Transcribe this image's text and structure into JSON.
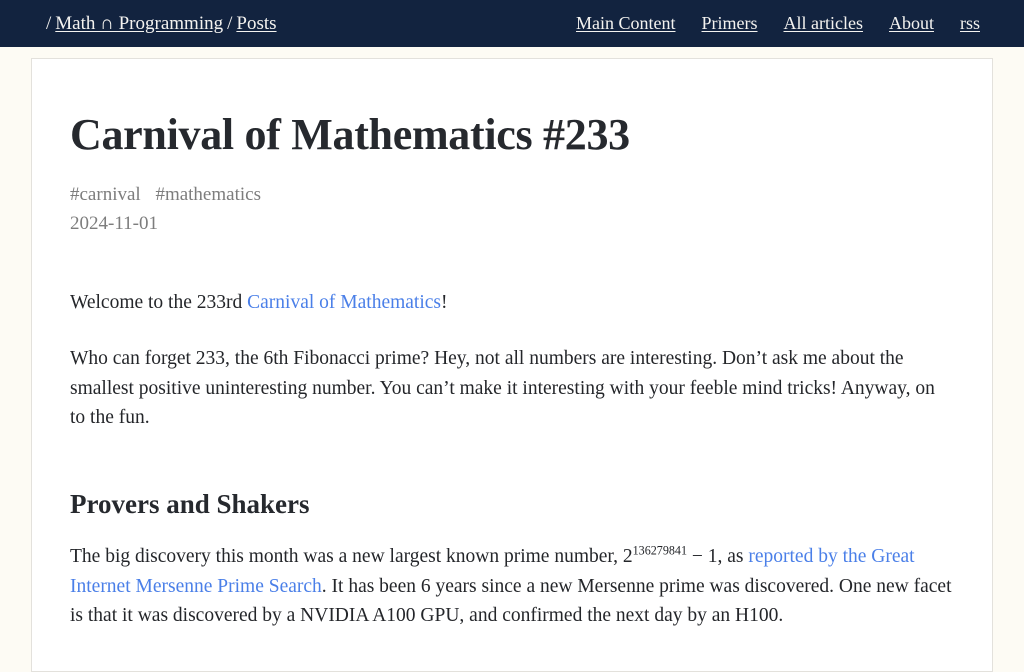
{
  "colors": {
    "nav_background": "#12233f",
    "page_background": "#fdfbf4",
    "card_background": "#ffffff",
    "card_border": "#e3e1dc",
    "link_blue": "#4a7fe8",
    "text": "#24262a",
    "meta_gray": "#7d7d7d"
  },
  "topnav": {
    "breadcrumb": {
      "leading_slash": "/",
      "site_label": "Math ∩ Programming",
      "separator": "/",
      "section_label": "Posts"
    },
    "links": [
      {
        "label": "Main Content"
      },
      {
        "label": "Primers"
      },
      {
        "label": "All articles"
      },
      {
        "label": "About"
      },
      {
        "label": "rss"
      }
    ]
  },
  "post": {
    "title": "Carnival of Mathematics #233",
    "tags": [
      "#carnival",
      "#mathematics"
    ],
    "date": "2024-11-01",
    "welcome": {
      "before_link": "Welcome to the 233rd ",
      "link_text": "Carnival of Mathematics",
      "after_link": "!"
    },
    "intro": "Who can forget 233, the 6th Fibonacci prime? Hey, not all numbers are interesting. Don’t ask me about the smallest positive uninteresting number. You can’t make it interesting with your feeble mind tricks! Anyway, on to the fun.",
    "section_heading": "Provers and Shakers",
    "provers": {
      "part1": "The big discovery this month was a new largest known prime number, ",
      "math_base": "2",
      "math_exponent": "136279841",
      "math_tail": " − 1",
      "part2": ", as ",
      "link_text": "reported by the Great Internet Mersenne Prime Search",
      "part3": ". It has been 6 years since a new Mersenne prime was discovered. One new facet is that it was discovered by a NVIDIA A100 GPU, and confirmed the next day by an H100."
    }
  }
}
